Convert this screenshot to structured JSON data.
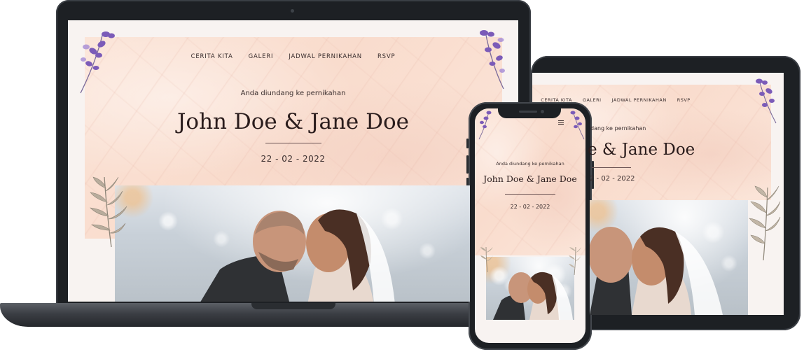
{
  "site": {
    "nav": [
      "CERITA KITA",
      "GALERI",
      "JADWAL PERNIKAHAN",
      "RSVP"
    ],
    "invite_text": "Anda diundang ke pernikahan",
    "couple_names": "John Doe & Jane Doe",
    "date": "22 - 02 - 2022",
    "menu_icon": "hamburger-menu-icon"
  },
  "tablet_view": {
    "couple_names_visible": "e & Jane Doe",
    "date_visible": "2 - 02 - 2022",
    "invite_visible": "dang ke pernikahan"
  },
  "colors": {
    "marble": "#fbe3d6",
    "paper": "#f8f3f1",
    "text": "#2a1c1c",
    "device": "#1d2024",
    "flower": "#7b5bb8"
  }
}
